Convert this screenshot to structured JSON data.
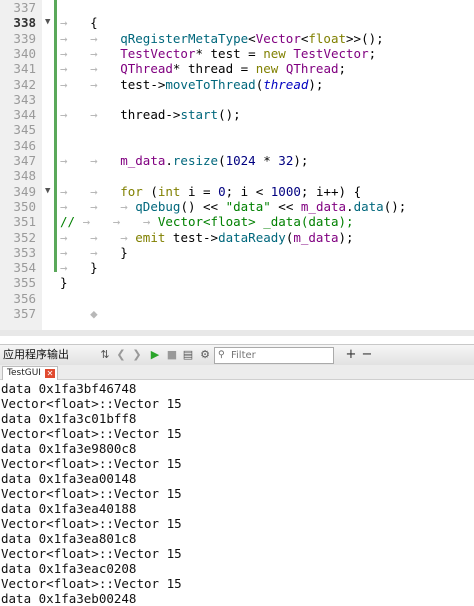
{
  "editor": {
    "line_numbers": [
      "337",
      "338",
      "339",
      "340",
      "341",
      "342",
      "343",
      "344",
      "345",
      "346",
      "347",
      "348",
      "349",
      "350",
      "351",
      "352",
      "353",
      "354",
      "355",
      "356",
      "357"
    ],
    "current_line": "338",
    "lines": [
      {
        "n": "337",
        "tokens": []
      },
      {
        "n": "338",
        "tokens": [
          {
            "t": "→",
            "c": "ws"
          },
          {
            "t": "   ",
            "c": "pl"
          },
          {
            "t": "{",
            "c": "pl"
          }
        ]
      },
      {
        "n": "339",
        "tokens": [
          {
            "t": "→",
            "c": "ws"
          },
          {
            "t": "   ",
            "c": "pl"
          },
          {
            "t": "→",
            "c": "ws"
          },
          {
            "t": "   ",
            "c": "pl"
          },
          {
            "t": "qRegisterMetaType",
            "c": "fn"
          },
          {
            "t": "<",
            "c": "pl"
          },
          {
            "t": "Vector",
            "c": "ty"
          },
          {
            "t": "<",
            "c": "pl"
          },
          {
            "t": "float",
            "c": "kw"
          },
          {
            "t": ">>();",
            "c": "pl"
          }
        ]
      },
      {
        "n": "340",
        "tokens": [
          {
            "t": "→",
            "c": "ws"
          },
          {
            "t": "   ",
            "c": "pl"
          },
          {
            "t": "→",
            "c": "ws"
          },
          {
            "t": "   ",
            "c": "pl"
          },
          {
            "t": "TestVector",
            "c": "ty"
          },
          {
            "t": "* test ",
            "c": "pl"
          },
          {
            "t": "=",
            "c": "pl"
          },
          {
            "t": " ",
            "c": "pl"
          },
          {
            "t": "new",
            "c": "kw"
          },
          {
            "t": " ",
            "c": "pl"
          },
          {
            "t": "TestVector",
            "c": "ty"
          },
          {
            "t": ";",
            "c": "pl"
          }
        ]
      },
      {
        "n": "341",
        "tokens": [
          {
            "t": "→",
            "c": "ws"
          },
          {
            "t": "   ",
            "c": "pl"
          },
          {
            "t": "→",
            "c": "ws"
          },
          {
            "t": "   ",
            "c": "pl"
          },
          {
            "t": "QThread",
            "c": "ty"
          },
          {
            "t": "* thread ",
            "c": "pl"
          },
          {
            "t": "=",
            "c": "pl"
          },
          {
            "t": " ",
            "c": "pl"
          },
          {
            "t": "new",
            "c": "kw"
          },
          {
            "t": " ",
            "c": "pl"
          },
          {
            "t": "QThread",
            "c": "ty"
          },
          {
            "t": ";",
            "c": "pl"
          }
        ]
      },
      {
        "n": "342",
        "tokens": [
          {
            "t": "→",
            "c": "ws"
          },
          {
            "t": "   ",
            "c": "pl"
          },
          {
            "t": "→",
            "c": "ws"
          },
          {
            "t": "   ",
            "c": "pl"
          },
          {
            "t": "test->",
            "c": "pl"
          },
          {
            "t": "moveToThread",
            "c": "fn"
          },
          {
            "t": "(",
            "c": "pl"
          },
          {
            "t": "thread",
            "c": "it"
          },
          {
            "t": ");",
            "c": "pl"
          }
        ]
      },
      {
        "n": "343",
        "tokens": []
      },
      {
        "n": "344",
        "tokens": [
          {
            "t": "→",
            "c": "ws"
          },
          {
            "t": "   ",
            "c": "pl"
          },
          {
            "t": "→",
            "c": "ws"
          },
          {
            "t": "   ",
            "c": "pl"
          },
          {
            "t": "thread->",
            "c": "pl"
          },
          {
            "t": "start",
            "c": "fn"
          },
          {
            "t": "();",
            "c": "pl"
          }
        ]
      },
      {
        "n": "345",
        "tokens": []
      },
      {
        "n": "346",
        "tokens": []
      },
      {
        "n": "347",
        "tokens": [
          {
            "t": "→",
            "c": "ws"
          },
          {
            "t": "   ",
            "c": "pl"
          },
          {
            "t": "→",
            "c": "ws"
          },
          {
            "t": "   ",
            "c": "pl"
          },
          {
            "t": "m_data",
            "c": "ty"
          },
          {
            "t": ".",
            "c": "pl"
          },
          {
            "t": "resize",
            "c": "fn"
          },
          {
            "t": "(",
            "c": "pl"
          },
          {
            "t": "1024",
            "c": "num"
          },
          {
            "t": " ",
            "c": "pl"
          },
          {
            "t": "*",
            "c": "pl"
          },
          {
            "t": " ",
            "c": "pl"
          },
          {
            "t": "32",
            "c": "num"
          },
          {
            "t": ");",
            "c": "pl"
          }
        ]
      },
      {
        "n": "348",
        "tokens": []
      },
      {
        "n": "349",
        "tokens": [
          {
            "t": "→",
            "c": "ws"
          },
          {
            "t": "   ",
            "c": "pl"
          },
          {
            "t": "→",
            "c": "ws"
          },
          {
            "t": "   ",
            "c": "pl"
          },
          {
            "t": "for",
            "c": "kw"
          },
          {
            "t": " (",
            "c": "pl"
          },
          {
            "t": "int",
            "c": "kw"
          },
          {
            "t": " i ",
            "c": "pl"
          },
          {
            "t": "=",
            "c": "pl"
          },
          {
            "t": " ",
            "c": "pl"
          },
          {
            "t": "0",
            "c": "num"
          },
          {
            "t": "; i ",
            "c": "pl"
          },
          {
            "t": "<",
            "c": "pl"
          },
          {
            "t": " ",
            "c": "pl"
          },
          {
            "t": "1000",
            "c": "num"
          },
          {
            "t": "; i++) {",
            "c": "pl"
          }
        ]
      },
      {
        "n": "350",
        "tokens": [
          {
            "t": "→",
            "c": "ws"
          },
          {
            "t": "   ",
            "c": "pl"
          },
          {
            "t": "→",
            "c": "ws"
          },
          {
            "t": "   ",
            "c": "pl"
          },
          {
            "t": "→",
            "c": "ws"
          },
          {
            "t": " ",
            "c": "pl"
          },
          {
            "t": "qDebug",
            "c": "fn"
          },
          {
            "t": "() ",
            "c": "pl"
          },
          {
            "t": "<<",
            "c": "pl"
          },
          {
            "t": " ",
            "c": "pl"
          },
          {
            "t": "\"data\"",
            "c": "str"
          },
          {
            "t": " ",
            "c": "pl"
          },
          {
            "t": "<<",
            "c": "pl"
          },
          {
            "t": " ",
            "c": "pl"
          },
          {
            "t": "m_data",
            "c": "ty"
          },
          {
            "t": ".",
            "c": "pl"
          },
          {
            "t": "data",
            "c": "fn"
          },
          {
            "t": "();",
            "c": "pl"
          }
        ]
      },
      {
        "n": "351",
        "tokens": [
          {
            "t": "//",
            "c": "cm"
          },
          {
            "t": " ",
            "c": "pl"
          },
          {
            "t": "→",
            "c": "ws"
          },
          {
            "t": "   ",
            "c": "pl"
          },
          {
            "t": "→",
            "c": "ws"
          },
          {
            "t": "   ",
            "c": "pl"
          },
          {
            "t": "→",
            "c": "ws"
          },
          {
            "t": " ",
            "c": "pl"
          },
          {
            "t": "Vector<float> _data(data);",
            "c": "cm"
          }
        ]
      },
      {
        "n": "352",
        "tokens": [
          {
            "t": "→",
            "c": "ws"
          },
          {
            "t": "   ",
            "c": "pl"
          },
          {
            "t": "→",
            "c": "ws"
          },
          {
            "t": "   ",
            "c": "pl"
          },
          {
            "t": "→",
            "c": "ws"
          },
          {
            "t": " ",
            "c": "pl"
          },
          {
            "t": "emit",
            "c": "kw"
          },
          {
            "t": " test->",
            "c": "pl"
          },
          {
            "t": "dataReady",
            "c": "fn"
          },
          {
            "t": "(",
            "c": "pl"
          },
          {
            "t": "m_data",
            "c": "ty"
          },
          {
            "t": ");",
            "c": "pl"
          }
        ]
      },
      {
        "n": "353",
        "tokens": [
          {
            "t": "→",
            "c": "ws"
          },
          {
            "t": "   ",
            "c": "pl"
          },
          {
            "t": "→",
            "c": "ws"
          },
          {
            "t": "   ",
            "c": "pl"
          },
          {
            "t": "}",
            "c": "pl"
          }
        ]
      },
      {
        "n": "354",
        "tokens": [
          {
            "t": "→",
            "c": "ws"
          },
          {
            "t": "   ",
            "c": "pl"
          },
          {
            "t": "}",
            "c": "pl"
          }
        ]
      },
      {
        "n": "355",
        "tokens": [
          {
            "t": "}",
            "c": "pl"
          }
        ]
      },
      {
        "n": "356",
        "tokens": []
      },
      {
        "n": "357",
        "tokens": [
          {
            "t": "    ",
            "c": "pl"
          },
          {
            "t": "◆",
            "c": "ws"
          }
        ]
      }
    ]
  },
  "output_pane": {
    "title": "应用程序输出",
    "filter_placeholder": "Filter",
    "add_label": "+",
    "remove_label": "−",
    "tab_label": "TestGUI",
    "tab_close_label": "✕",
    "lines": [
      "data 0x1fa3bf46748",
      "Vector<float>::Vector 15",
      "data 0x1fa3c01bff8",
      "Vector<float>::Vector 15",
      "data 0x1fa3e9800c8",
      "Vector<float>::Vector 15",
      "data 0x1fa3ea00148",
      "Vector<float>::Vector 15",
      "data 0x1fa3ea40188",
      "Vector<float>::Vector 15",
      "data 0x1fa3ea801c8",
      "Vector<float>::Vector 15",
      "data 0x1fa3eac0208",
      "Vector<float>::Vector 15",
      "data 0x1fa3eb00248"
    ]
  },
  "icons": {
    "toolbar": [
      "sort-icon",
      "lock-icon",
      "prev-icon",
      "next-icon",
      "run-icon",
      "stop-icon",
      "attach-icon",
      "settings-icon",
      "filter-icon"
    ]
  }
}
